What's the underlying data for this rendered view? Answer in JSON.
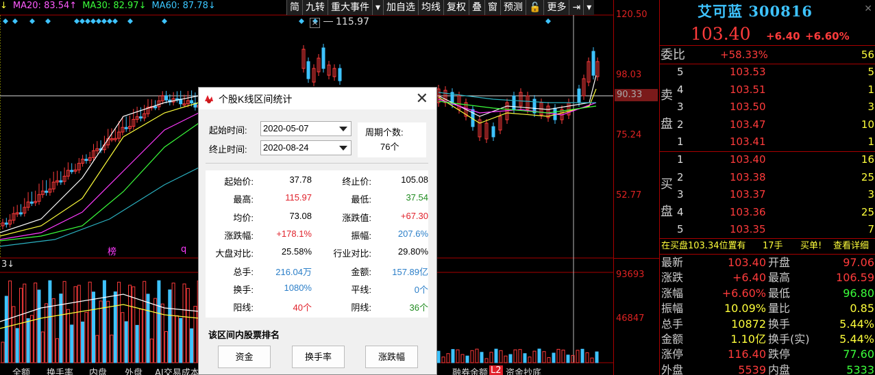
{
  "colors": {
    "up": "#ff3b3b",
    "down": "#3ec3ff",
    "grid": "#aa0000",
    "ma5": "#ffffff",
    "ma10": "#ffff3b",
    "ma20": "#ff3bff",
    "ma30": "#3bff3b",
    "ma60": "#2bb3c3"
  },
  "ma_legend": [
    {
      "text": "MA20: 83.54↑",
      "color": "#ff5bff"
    },
    {
      "text": "MA30: 82.97↓",
      "color": "#3bff3b"
    },
    {
      "text": "MA60: 87.78↓",
      "color": "#3bc7ff"
    }
  ],
  "toolbar": [
    "简",
    "九转",
    "重大事件",
    "▾",
    "加自选",
    "均线",
    "复权",
    "叠",
    "窗",
    "预测",
    "🔓",
    "更多",
    "⇥",
    "▾"
  ],
  "high_marker": "115.97",
  "price_axis": [
    "120.50",
    "98.03",
    "75.24",
    "52.77"
  ],
  "price_tag": "90.33",
  "volume_axis": [
    "93693",
    "46847"
  ],
  "chart_labels": {
    "bang": "榜",
    "q": "q",
    "vol_head": "3↓"
  },
  "bottom_tabs": [
    "全额",
    "换手率",
    "内盘",
    "外盘",
    "AI交易成本",
    "融券余额",
    "资金抄底"
  ],
  "bottom_badge": "L2",
  "quote": {
    "name": "艾可蓝",
    "code": "300816",
    "price": "103.40",
    "change": "+6.40",
    "change_pct": "+6.60%",
    "weibi_label": "委比",
    "weibi_value": "+58.33%",
    "weibi_count": "56",
    "sell_side_label": [
      "卖",
      "盘"
    ],
    "buy_side_label": [
      "买",
      "盘"
    ],
    "sell": [
      {
        "lvl": "5",
        "price": "103.53",
        "vol": "5"
      },
      {
        "lvl": "4",
        "price": "103.51",
        "vol": "1"
      },
      {
        "lvl": "3",
        "price": "103.50",
        "vol": "3"
      },
      {
        "lvl": "2",
        "price": "103.47",
        "vol": "10"
      },
      {
        "lvl": "1",
        "price": "103.41",
        "vol": "1"
      }
    ],
    "buy": [
      {
        "lvl": "1",
        "price": "103.40",
        "vol": "16"
      },
      {
        "lvl": "2",
        "price": "103.38",
        "vol": "25"
      },
      {
        "lvl": "3",
        "price": "103.37",
        "vol": "3"
      },
      {
        "lvl": "4",
        "price": "103.36",
        "vol": "25"
      },
      {
        "lvl": "5",
        "price": "103.35",
        "vol": "7"
      }
    ],
    "notice": {
      "text": "在买盘103.34位置有",
      "qty": "17手",
      "tag": "买单!",
      "link": "查看详细"
    },
    "stats": [
      {
        "l": "最新",
        "v": "103.40",
        "vc": "#ff3b3b",
        "l2": "开盘",
        "v2": "97.06",
        "v2c": "#ff3b3b"
      },
      {
        "l": "涨跌",
        "v": "+6.40",
        "vc": "#ff3b3b",
        "l2": "最高",
        "v2": "106.59",
        "v2c": "#ff3b3b"
      },
      {
        "l": "涨幅",
        "v": "+6.60%",
        "vc": "#ff3b3b",
        "l2": "最低",
        "v2": "96.80",
        "v2c": "#3bff3b"
      },
      {
        "l": "振幅",
        "v": "10.09%",
        "vc": "#ffff3b",
        "l2": "量比",
        "v2": "0.85",
        "v2c": "#ffff3b"
      },
      {
        "l": "总手",
        "v": "10872",
        "vc": "#ffff3b",
        "l2": "换手",
        "v2": "5.44%",
        "v2c": "#ffff3b"
      },
      {
        "l": "金额",
        "v": "1.10亿",
        "vc": "#ffff3b",
        "l2": "换手(实)",
        "v2": "5.44%",
        "v2c": "#ffff3b"
      },
      {
        "l": "涨停",
        "v": "116.40",
        "vc": "#ff3b3b",
        "l2": "跌停",
        "v2": "77.60",
        "v2c": "#3bff3b"
      },
      {
        "l": "外盘",
        "v": "5539",
        "vc": "#ff3b3b",
        "l2": "内盘",
        "v2": "5333",
        "v2c": "#3bff3b"
      }
    ]
  },
  "dialog": {
    "title": "个股K线区间统计",
    "start_label": "起始时间:",
    "start_value": "2020-05-07",
    "end_label": "终止时间:",
    "end_value": "2020-08-24",
    "period_label": "周期个数:",
    "period_value": "76个",
    "stats": [
      {
        "l1": "起始价:",
        "v1": "37.78",
        "c1": "#000000",
        "l2": "终止价:",
        "v2": "105.08",
        "c2": "#000000"
      },
      {
        "l1": "最高:",
        "v1": "115.97",
        "c1": "#e0202a",
        "l2": "最低:",
        "v2": "37.54",
        "c2": "#1e8a1e"
      },
      {
        "l1": "均价:",
        "v1": "73.08",
        "c1": "#000000",
        "l2": "涨跌值:",
        "v2": "+67.30",
        "c2": "#e0202a"
      },
      {
        "l1": "涨跌幅:",
        "v1": "+178.1%",
        "c1": "#e0202a",
        "l2": "振幅:",
        "v2": "207.6%",
        "c2": "#2a7ec8"
      },
      {
        "l1": "大盘对比:",
        "v1": "25.58%",
        "c1": "#000000",
        "l2": "行业对比:",
        "v2": "29.80%",
        "c2": "#000000"
      },
      {
        "l1": "总手:",
        "v1": "216.04万",
        "c1": "#2a7ec8",
        "l2": "金额:",
        "v2": "157.89亿",
        "c2": "#2a7ec8"
      },
      {
        "l1": "换手:",
        "v1": "1080%",
        "c1": "#2a7ec8",
        "l2": "平线:",
        "v2": "0个",
        "c2": "#2a7ec8"
      },
      {
        "l1": "阳线:",
        "v1": "40个",
        "c1": "#e0202a",
        "l2": "阴线:",
        "v2": "36个",
        "c2": "#1e8a1e"
      }
    ],
    "ranking_label": "该区间内股票排名",
    "buttons": [
      "资金",
      "换手率",
      "涨跌幅"
    ]
  }
}
